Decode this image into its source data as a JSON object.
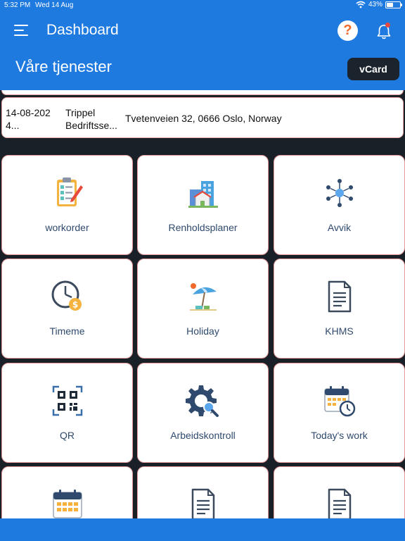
{
  "statusbar": {
    "time": "5:32 PM",
    "date": "Wed 14 Aug",
    "battery": "43%",
    "battery_level": 0.43
  },
  "appbar": {
    "title": "Dashboard",
    "help_label": "?"
  },
  "section": {
    "title": "Våre tjenester",
    "vcard_label": "vCard"
  },
  "info": {
    "date": "14-08-202 4...",
    "company": "Trippel Bedriftsse...",
    "address": "Tvetenveien 32, 0666 Oslo, Norway"
  },
  "tiles": [
    {
      "label": "workorder",
      "icon": "clipboard-checklist-icon"
    },
    {
      "label": "Renholdsplaner",
      "icon": "buildings-icon"
    },
    {
      "label": "Avvik",
      "icon": "network-icon"
    },
    {
      "label": "Timeme",
      "icon": "clock-money-icon"
    },
    {
      "label": "Holiday",
      "icon": "beach-umbrella-icon"
    },
    {
      "label": "KHMS",
      "icon": "document-icon"
    },
    {
      "label": "QR",
      "icon": "qr-code-icon"
    },
    {
      "label": "Arbeidskontroll",
      "icon": "gear-search-icon"
    },
    {
      "label": "Today's work",
      "icon": "calendar-clock-icon"
    },
    {
      "label": "",
      "icon": "calendar-icon"
    },
    {
      "label": "",
      "icon": "document-icon"
    },
    {
      "label": "",
      "icon": "document-icon"
    }
  ],
  "colors": {
    "primary": "#1f7ae0",
    "background": "#1a2028",
    "label": "#2f4a6d",
    "tile_border": "#e69a9a",
    "accent_orange": "#f26a2b"
  }
}
